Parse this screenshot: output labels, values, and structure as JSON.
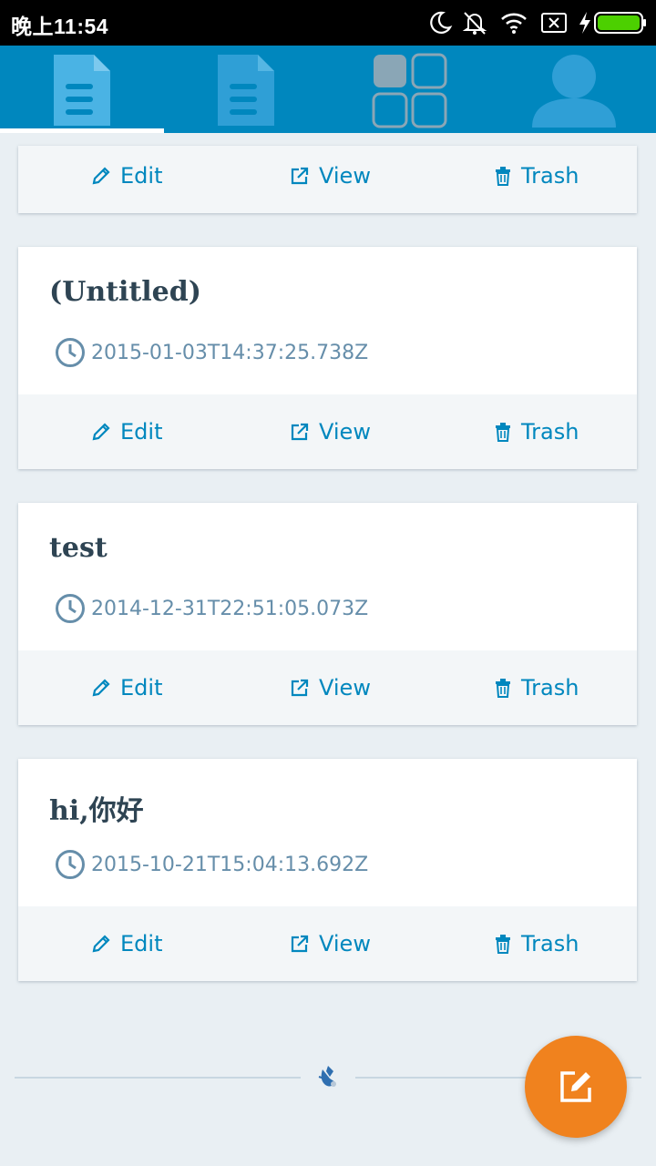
{
  "status_bar": {
    "time": "晚上11:54",
    "icons": [
      "moon-icon",
      "bell-off-icon",
      "wifi-icon",
      "sim-off-icon",
      "charging-icon",
      "battery-icon"
    ]
  },
  "tabs": [
    {
      "name": "posts-tab",
      "icon": "document-icon",
      "selected": true
    },
    {
      "name": "pages-tab",
      "icon": "document-icon",
      "selected": false
    },
    {
      "name": "grid-tab",
      "icon": "grid-icon",
      "selected": false
    },
    {
      "name": "profile-tab",
      "icon": "person-icon",
      "selected": false
    }
  ],
  "actions": {
    "edit": "Edit",
    "view": "View",
    "trash": "Trash"
  },
  "posts": [
    {
      "title": "(Untitled)",
      "date": "2015-01-03T14:37:25.738Z"
    },
    {
      "title": "test",
      "date": "2014-12-31T22:51:05.073Z"
    },
    {
      "title": "hi,你好",
      "date": "2015-10-21T15:04:13.692Z"
    }
  ],
  "colors": {
    "tab_bar": "#0087be",
    "accent": "#0087be",
    "fab": "#f0821e",
    "background": "#e9eff3",
    "title": "#2e4453",
    "date": "#668eaa"
  }
}
